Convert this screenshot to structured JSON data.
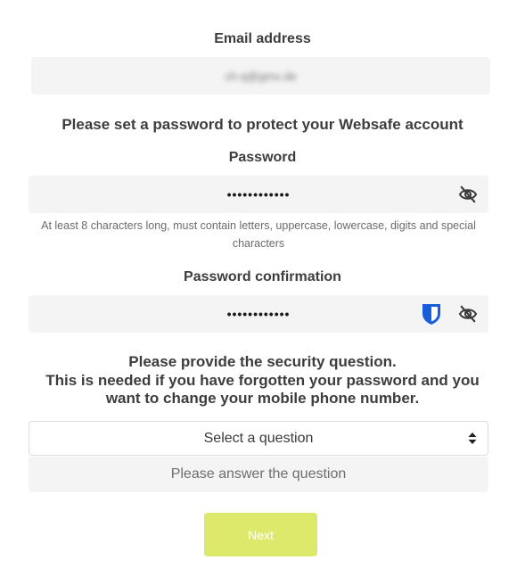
{
  "email": {
    "label": "Email address",
    "value": "ch.q@gmx.de"
  },
  "intro": "Please set a password to protect your Websafe account",
  "password": {
    "label": "Password",
    "value": "••••••••••••",
    "toggle_icon": "eye-slash-icon",
    "hint": "At least 8 characters long, must contain letters, uppercase, lowercase, digits and special characters"
  },
  "confirmation": {
    "label": "Password confirmation",
    "value": "••••••••••••",
    "extension_icon": "bitwarden-shield-icon",
    "toggle_icon": "eye-slash-icon"
  },
  "security": {
    "line1": "Please provide the security question.",
    "line2": "This is needed if you have forgotten your password and you",
    "line3": "want to change your mobile phone number.",
    "select_value": "Select a question",
    "answer_placeholder": "Please answer the question"
  },
  "next_button": "Next",
  "colors": {
    "field_bg": "#f4f4f4",
    "button_bg": "#dde96a",
    "shield_blue": "#175ddc"
  }
}
